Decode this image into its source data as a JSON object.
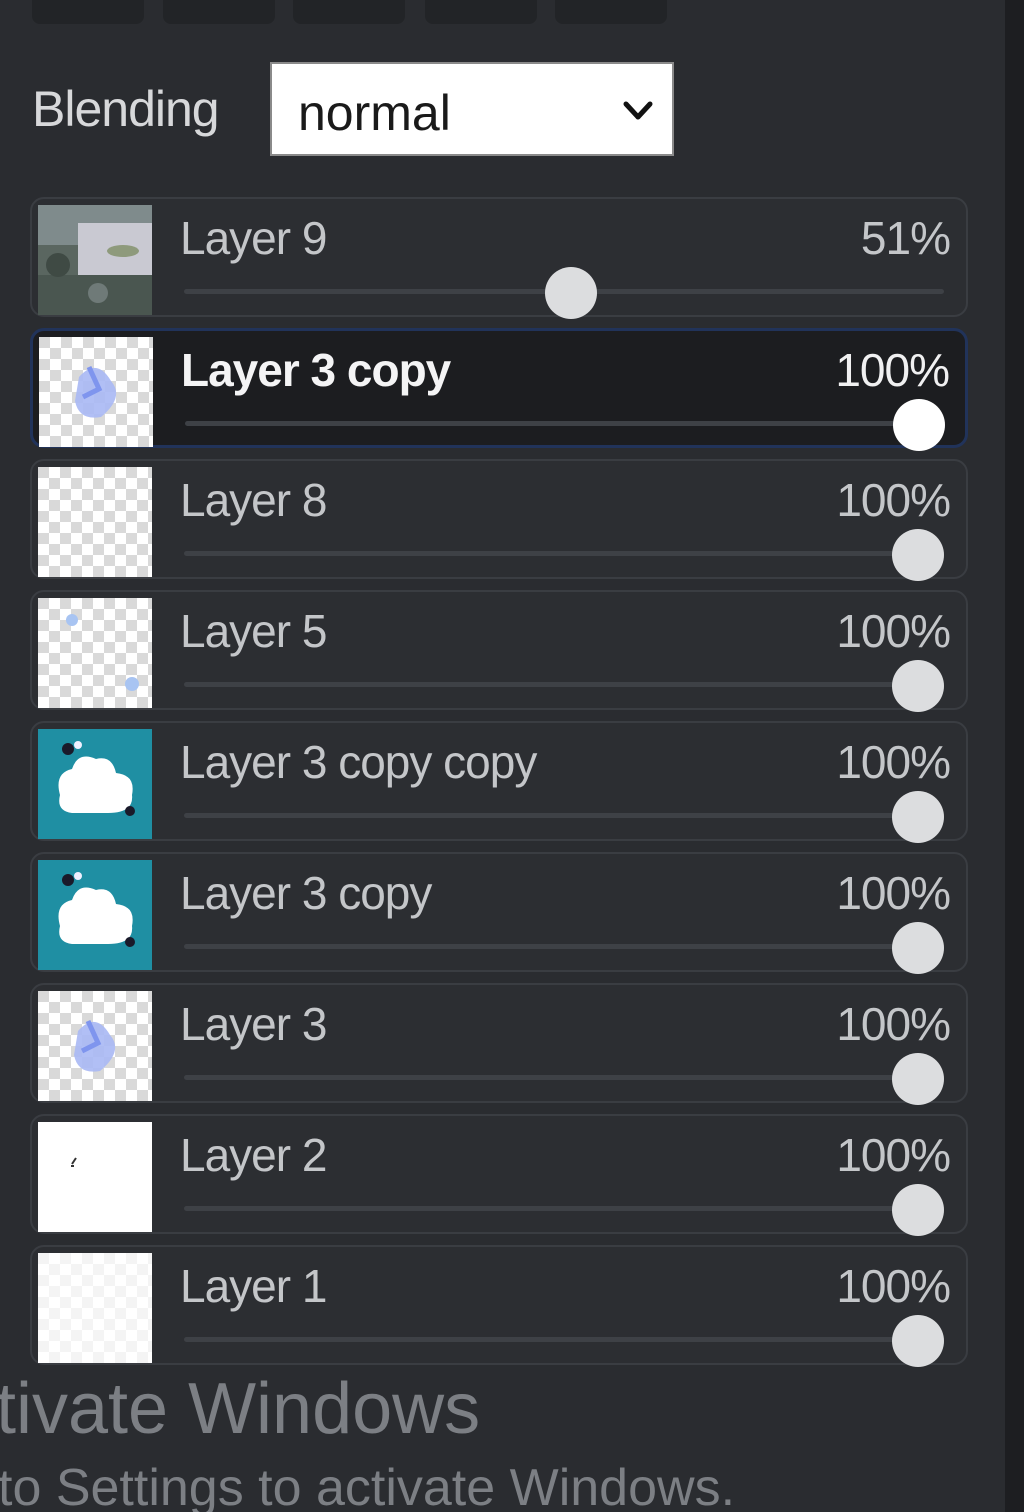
{
  "blending": {
    "label": "Blending",
    "selected": "normal"
  },
  "layers": [
    {
      "name": "Layer 9",
      "opacity_label": "51%",
      "opacity": 0.51,
      "selected": false,
      "thumb": "photo"
    },
    {
      "name": "Layer 3 copy",
      "opacity_label": "100%",
      "opacity": 1.0,
      "selected": true,
      "thumb": "blue-sketch"
    },
    {
      "name": "Layer 8",
      "opacity_label": "100%",
      "opacity": 1.0,
      "selected": false,
      "thumb": "transparent"
    },
    {
      "name": "Layer 5",
      "opacity_label": "100%",
      "opacity": 1.0,
      "selected": false,
      "thumb": "blue-dots"
    },
    {
      "name": "Layer 3 copy copy",
      "opacity_label": "100%",
      "opacity": 1.0,
      "selected": false,
      "thumb": "teal-cloud"
    },
    {
      "name": "Layer 3 copy",
      "opacity_label": "100%",
      "opacity": 1.0,
      "selected": false,
      "thumb": "teal-cloud"
    },
    {
      "name": "Layer 3",
      "opacity_label": "100%",
      "opacity": 1.0,
      "selected": false,
      "thumb": "blue-sketch"
    },
    {
      "name": "Layer 2",
      "opacity_label": "100%",
      "opacity": 1.0,
      "selected": false,
      "thumb": "white"
    },
    {
      "name": "Layer 1",
      "opacity_label": "100%",
      "opacity": 1.0,
      "selected": false,
      "thumb": "transparent-faint"
    }
  ],
  "watermark": {
    "title": "tivate Windows",
    "subtitle": "to Settings to activate Windows."
  },
  "colors": {
    "panel_bg": "#2a2c30",
    "selected_row_bg": "#1c1d20",
    "selected_border": "#21335a",
    "teal_thumb": "#1f8fa3"
  }
}
